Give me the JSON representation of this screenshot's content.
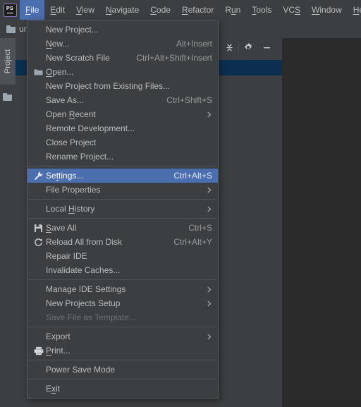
{
  "app": {
    "logo_text": "PS",
    "logo_name": "phpstorm-logo"
  },
  "menubar": {
    "items": [
      {
        "label": "File",
        "mnemonic": "F",
        "active": true
      },
      {
        "label": "Edit",
        "mnemonic": "E",
        "active": false
      },
      {
        "label": "View",
        "mnemonic": "V",
        "active": false
      },
      {
        "label": "Navigate",
        "mnemonic": "N",
        "active": false
      },
      {
        "label": "Code",
        "mnemonic": "C",
        "active": false
      },
      {
        "label": "Refactor",
        "mnemonic": "R",
        "active": false
      },
      {
        "label": "Run",
        "mnemonic": "u",
        "active": false
      },
      {
        "label": "Tools",
        "mnemonic": "T",
        "active": false
      },
      {
        "label": "VCS",
        "mnemonic": "S",
        "active": false
      },
      {
        "label": "Window",
        "mnemonic": "W",
        "active": false
      },
      {
        "label": "Help",
        "mnemonic": "H",
        "active": false
      }
    ]
  },
  "toolwindow": {
    "breadcrumb_project": "un",
    "vertical_tab_label": "Project",
    "buttons": [
      {
        "name": "collapse-all-icon",
        "title": "Collapse All"
      },
      {
        "name": "gear-icon",
        "title": "Settings"
      },
      {
        "name": "minimize-icon",
        "title": "Hide"
      }
    ]
  },
  "colors": {
    "window_bg": "#3c3f41",
    "editor_bg": "#2b2b2b",
    "menu_bg": "#3c3f41",
    "menu_border": "#565a5c",
    "selection_blue": "#4b6eaf",
    "tree_selection": "#0d2f4f",
    "text": "#bbbbbb",
    "text_disabled": "#6e7274",
    "shortcut_text": "#999999",
    "accent_purple": "#8f6fd0"
  },
  "file_menu": {
    "title": "File",
    "items": [
      {
        "type": "item",
        "label": "New Project...",
        "shortcut": "",
        "icon": "",
        "submenu": false,
        "disabled": false,
        "selected": false,
        "mnemonic": ""
      },
      {
        "type": "item",
        "label": "New...",
        "shortcut": "Alt+Insert",
        "icon": "",
        "submenu": false,
        "disabled": false,
        "selected": false,
        "mnemonic": "N"
      },
      {
        "type": "item",
        "label": "New Scratch File",
        "shortcut": "Ctrl+Alt+Shift+Insert",
        "icon": "",
        "submenu": false,
        "disabled": false,
        "selected": false,
        "mnemonic": ""
      },
      {
        "type": "item",
        "label": "Open...",
        "shortcut": "",
        "icon": "folder-icon",
        "submenu": false,
        "disabled": false,
        "selected": false,
        "mnemonic": "O"
      },
      {
        "type": "item",
        "label": "New Project from Existing Files...",
        "shortcut": "",
        "icon": "",
        "submenu": false,
        "disabled": false,
        "selected": false,
        "mnemonic": ""
      },
      {
        "type": "item",
        "label": "Save As...",
        "shortcut": "Ctrl+Shift+S",
        "icon": "",
        "submenu": false,
        "disabled": false,
        "selected": false,
        "mnemonic": ""
      },
      {
        "type": "item",
        "label": "Open Recent",
        "shortcut": "",
        "icon": "",
        "submenu": true,
        "disabled": false,
        "selected": false,
        "mnemonic": "R"
      },
      {
        "type": "item",
        "label": "Remote Development...",
        "shortcut": "",
        "icon": "",
        "submenu": false,
        "disabled": false,
        "selected": false,
        "mnemonic": ""
      },
      {
        "type": "item",
        "label": "Close Project",
        "shortcut": "",
        "icon": "",
        "submenu": false,
        "disabled": false,
        "selected": false,
        "mnemonic": ""
      },
      {
        "type": "item",
        "label": "Rename Project...",
        "shortcut": "",
        "icon": "",
        "submenu": false,
        "disabled": false,
        "selected": false,
        "mnemonic": ""
      },
      {
        "type": "separator"
      },
      {
        "type": "item",
        "label": "Settings...",
        "shortcut": "Ctrl+Alt+S",
        "icon": "wrench-icon",
        "submenu": false,
        "disabled": false,
        "selected": true,
        "mnemonic": "t"
      },
      {
        "type": "item",
        "label": "File Properties",
        "shortcut": "",
        "icon": "",
        "submenu": true,
        "disabled": false,
        "selected": false,
        "mnemonic": ""
      },
      {
        "type": "separator"
      },
      {
        "type": "item",
        "label": "Local History",
        "shortcut": "",
        "icon": "",
        "submenu": true,
        "disabled": false,
        "selected": false,
        "mnemonic": "H"
      },
      {
        "type": "separator"
      },
      {
        "type": "item",
        "label": "Save All",
        "shortcut": "Ctrl+S",
        "icon": "save-icon",
        "submenu": false,
        "disabled": false,
        "selected": false,
        "mnemonic": "S"
      },
      {
        "type": "item",
        "label": "Reload All from Disk",
        "shortcut": "Ctrl+Alt+Y",
        "icon": "reload-icon",
        "submenu": false,
        "disabled": false,
        "selected": false,
        "mnemonic": ""
      },
      {
        "type": "item",
        "label": "Repair IDE",
        "shortcut": "",
        "icon": "",
        "submenu": false,
        "disabled": false,
        "selected": false,
        "mnemonic": ""
      },
      {
        "type": "item",
        "label": "Invalidate Caches...",
        "shortcut": "",
        "icon": "",
        "submenu": false,
        "disabled": false,
        "selected": false,
        "mnemonic": ""
      },
      {
        "type": "separator"
      },
      {
        "type": "item",
        "label": "Manage IDE Settings",
        "shortcut": "",
        "icon": "",
        "submenu": true,
        "disabled": false,
        "selected": false,
        "mnemonic": ""
      },
      {
        "type": "item",
        "label": "New Projects Setup",
        "shortcut": "",
        "icon": "",
        "submenu": true,
        "disabled": false,
        "selected": false,
        "mnemonic": ""
      },
      {
        "type": "item",
        "label": "Save File as Template...",
        "shortcut": "",
        "icon": "",
        "submenu": false,
        "disabled": true,
        "selected": false,
        "mnemonic": ""
      },
      {
        "type": "separator"
      },
      {
        "type": "item",
        "label": "Export",
        "shortcut": "",
        "icon": "",
        "submenu": true,
        "disabled": false,
        "selected": false,
        "mnemonic": ""
      },
      {
        "type": "item",
        "label": "Print...",
        "shortcut": "",
        "icon": "printer-icon",
        "submenu": false,
        "disabled": false,
        "selected": false,
        "mnemonic": "P"
      },
      {
        "type": "separator"
      },
      {
        "type": "item",
        "label": "Power Save Mode",
        "shortcut": "",
        "icon": "",
        "submenu": false,
        "disabled": false,
        "selected": false,
        "mnemonic": ""
      },
      {
        "type": "separator"
      },
      {
        "type": "item",
        "label": "Exit",
        "shortcut": "",
        "icon": "",
        "submenu": false,
        "disabled": false,
        "selected": false,
        "mnemonic": "x"
      }
    ]
  }
}
